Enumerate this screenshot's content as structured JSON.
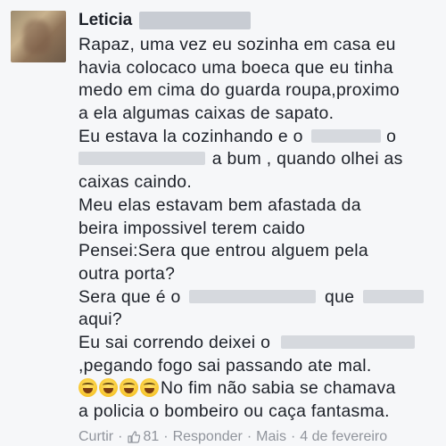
{
  "comment": {
    "author": "Leticia",
    "lines": [
      "Rapaz, uma vez eu sozinha em casa eu",
      "havia colocaco uma boeca que eu tinha",
      "medo em cima do guarda roupa,proximo",
      "a ela algumas caixas de sapato.",
      "Eu estava la cozinhando e o",
      "a bum , quando olhei as",
      "caixas caindo.",
      "Meu elas estavam bem afastada da",
      "beira impossivel terem caido",
      "Pensei:Sera que entrou alguem pela",
      "outra porta?",
      "Sera que é o",
      "que",
      "aqui?",
      "Eu sai correndo deixei o",
      ",pegando fogo sai passando ate mal.",
      "No fim não sabia se chamava",
      "a policia o bombeiro ou caça fantasma."
    ],
    "tail_o": "o",
    "emoji_name": "laughing-tears-emoji"
  },
  "footer": {
    "reply_action": "Curtir",
    "like_count": "81",
    "respond_action": "Responder",
    "more_action": "Mais",
    "timestamp": "4 de fevereiro",
    "separator": "·"
  }
}
